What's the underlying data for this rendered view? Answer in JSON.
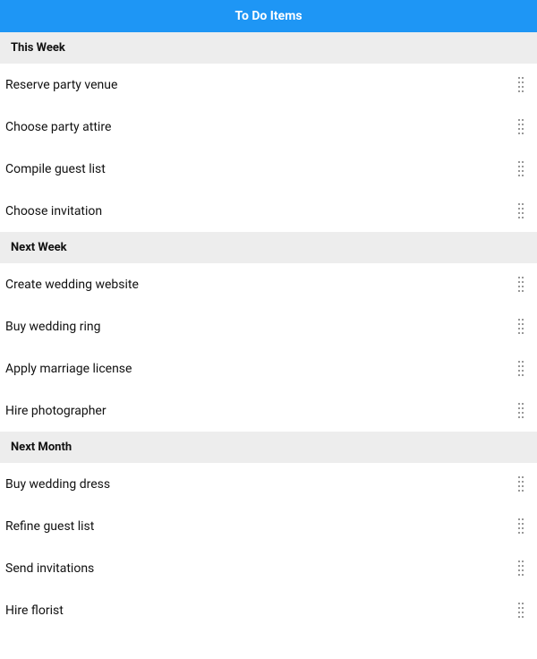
{
  "header": {
    "title": "To Do Items"
  },
  "sections": [
    {
      "title": "This Week",
      "items": [
        {
          "label": "Reserve party venue"
        },
        {
          "label": "Choose party attire"
        },
        {
          "label": "Compile guest list"
        },
        {
          "label": "Choose invitation"
        }
      ]
    },
    {
      "title": "Next Week",
      "items": [
        {
          "label": "Create wedding website"
        },
        {
          "label": "Buy wedding ring"
        },
        {
          "label": "Apply marriage license"
        },
        {
          "label": "Hire photographer"
        }
      ]
    },
    {
      "title": "Next Month",
      "items": [
        {
          "label": "Buy wedding dress"
        },
        {
          "label": "Refine guest list"
        },
        {
          "label": "Send invitations"
        },
        {
          "label": "Hire florist"
        }
      ]
    }
  ]
}
